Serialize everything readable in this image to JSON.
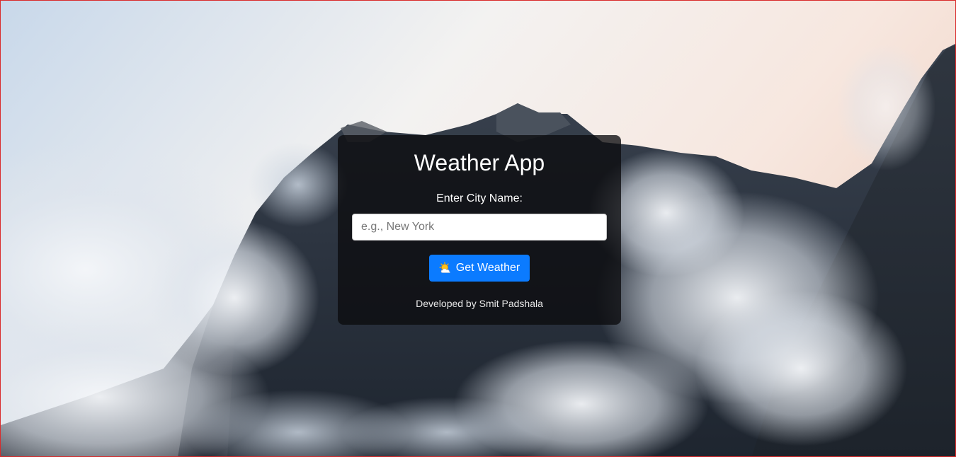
{
  "app": {
    "title": "Weather App"
  },
  "form": {
    "label": "Enter City Name:",
    "input_value": "",
    "input_placeholder": "e.g., New York",
    "button_label": "Get Weather",
    "button_icon": "sun-behind-cloud-icon"
  },
  "footer": {
    "credit": "Developed by Smit Padshala"
  },
  "colors": {
    "button": "#0b7bff",
    "card_background": "rgba(12,12,14,0.78)",
    "page_border": "#d92b2b"
  },
  "background": {
    "image": "misty-mountain-peaks-photo"
  }
}
